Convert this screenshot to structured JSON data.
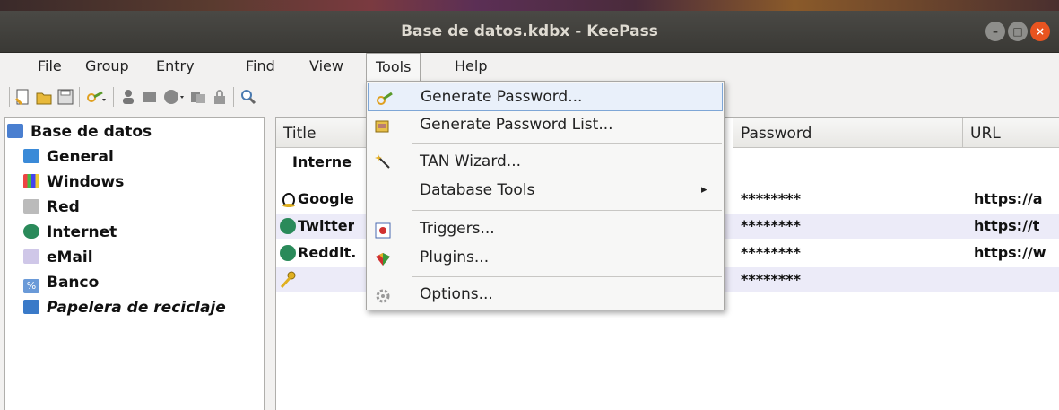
{
  "window": {
    "title": "Base de datos.kdbx - KeePass"
  },
  "menubar": {
    "file": "File",
    "group": "Group",
    "entry": "Entry",
    "find": "Find",
    "view": "View",
    "tools": "Tools",
    "help": "Help"
  },
  "tools_menu": {
    "generate_password": "Generate Password...",
    "generate_password_list": "Generate Password List...",
    "tan_wizard": "TAN Wizard...",
    "database_tools": "Database Tools",
    "database_tools_arrow": "▸",
    "triggers": "Triggers...",
    "plugins": "Plugins...",
    "options": "Options..."
  },
  "tree": {
    "root": "Base de datos",
    "items": [
      "General",
      "Windows",
      "Red",
      "Internet",
      "eMail",
      "Banco",
      "Papelera de reciclaje"
    ]
  },
  "list": {
    "columns": {
      "title": "Title",
      "password": "Password",
      "url": "URL"
    },
    "group_header": "Interne",
    "rows": [
      {
        "title": "Google",
        "password": "********",
        "url": "https://a"
      },
      {
        "title": "Twitter",
        "password": "********",
        "url": "https://t"
      },
      {
        "title": "Reddit.",
        "password": "********",
        "url": "https://w"
      },
      {
        "title": "",
        "password": "********",
        "url": ""
      }
    ]
  },
  "colors": {
    "titlebar": "#3c3b37",
    "close_button": "#e95420",
    "highlight": "#e9f0fa",
    "row_alt": "#ecebf8"
  },
  "icons": {
    "tree": [
      "folder-open-icon",
      "folder-icon",
      "windows-icon",
      "network-icon",
      "globe-icon",
      "email-icon",
      "percent-icon",
      "recycle-bin-icon"
    ],
    "menu": [
      "key-wand-icon",
      "key-list-icon",
      "magic-wand-icon",
      "triggers-icon",
      "plugins-icon",
      "gear-icon"
    ]
  }
}
